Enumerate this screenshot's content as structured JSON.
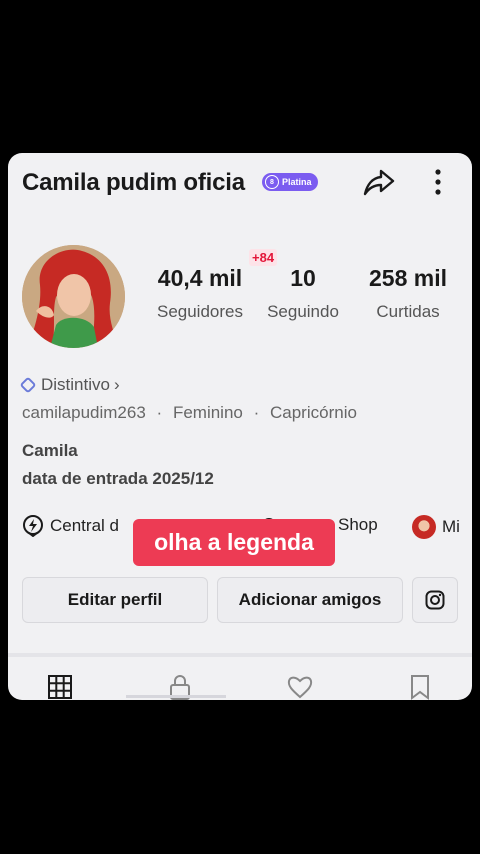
{
  "profile": {
    "display_name": "Camila pudim oficia",
    "badge_label": "Platina",
    "badge_icon": "group-icon",
    "username": "camilapudim263",
    "gender": "Feminino",
    "sign": "Capricórnio",
    "meta_separator": "·",
    "first_name": "Camila",
    "joined": "data de entrada 2025/12",
    "distintivo": "Distintivo",
    "chevron": "›"
  },
  "stats": {
    "followers_value": "40,4 mil",
    "followers_label": "Seguidores",
    "new_followers": "+84",
    "following_value": "10",
    "following_label": "Seguindo",
    "likes_value": "258 mil",
    "likes_label": "Curtidas"
  },
  "links": {
    "central_label": "Central d",
    "shop_label": "Shop",
    "mini_label": "Mi"
  },
  "buttons": {
    "edit_profile": "Editar perfil",
    "add_friends": "Adicionar amigos"
  },
  "caption": "olha a legenda",
  "colors": {
    "accent_purple": "#7b5cf0",
    "caption_red": "#ed3b54",
    "plus_red": "#e3173a",
    "card_bg": "#f1f1f3"
  }
}
